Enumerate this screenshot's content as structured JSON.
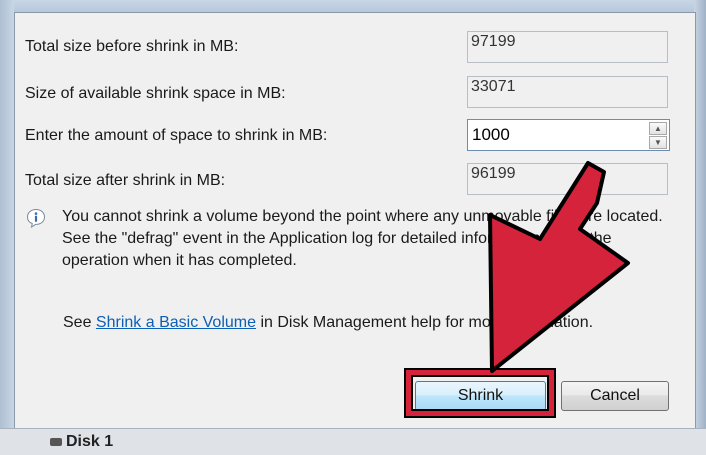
{
  "fields": [
    {
      "label": "Total size before shrink in MB:",
      "value": "97199"
    },
    {
      "label": "Size of available shrink space in MB:",
      "value": "33071"
    },
    {
      "label": "Enter the amount of space to shrink in MB:",
      "value": "1000"
    },
    {
      "label": "Total size after shrink in MB:",
      "value": "96199"
    }
  ],
  "info": {
    "icon": "info-icon",
    "text": "You cannot shrink a volume beyond the point where any unmovable files are located. See the \"defrag\" event in the Application log for detailed information about the operation when it has completed."
  },
  "help": {
    "prefix": "See ",
    "link": "Shrink a Basic Volume",
    "suffix": " in Disk Management help for more information."
  },
  "buttons": {
    "shrink": "Shrink",
    "cancel": "Cancel"
  },
  "background": {
    "disk_label": "Disk 1"
  },
  "annotation": {
    "arrow_color": "#d4233a",
    "outline_color": "#000000"
  }
}
